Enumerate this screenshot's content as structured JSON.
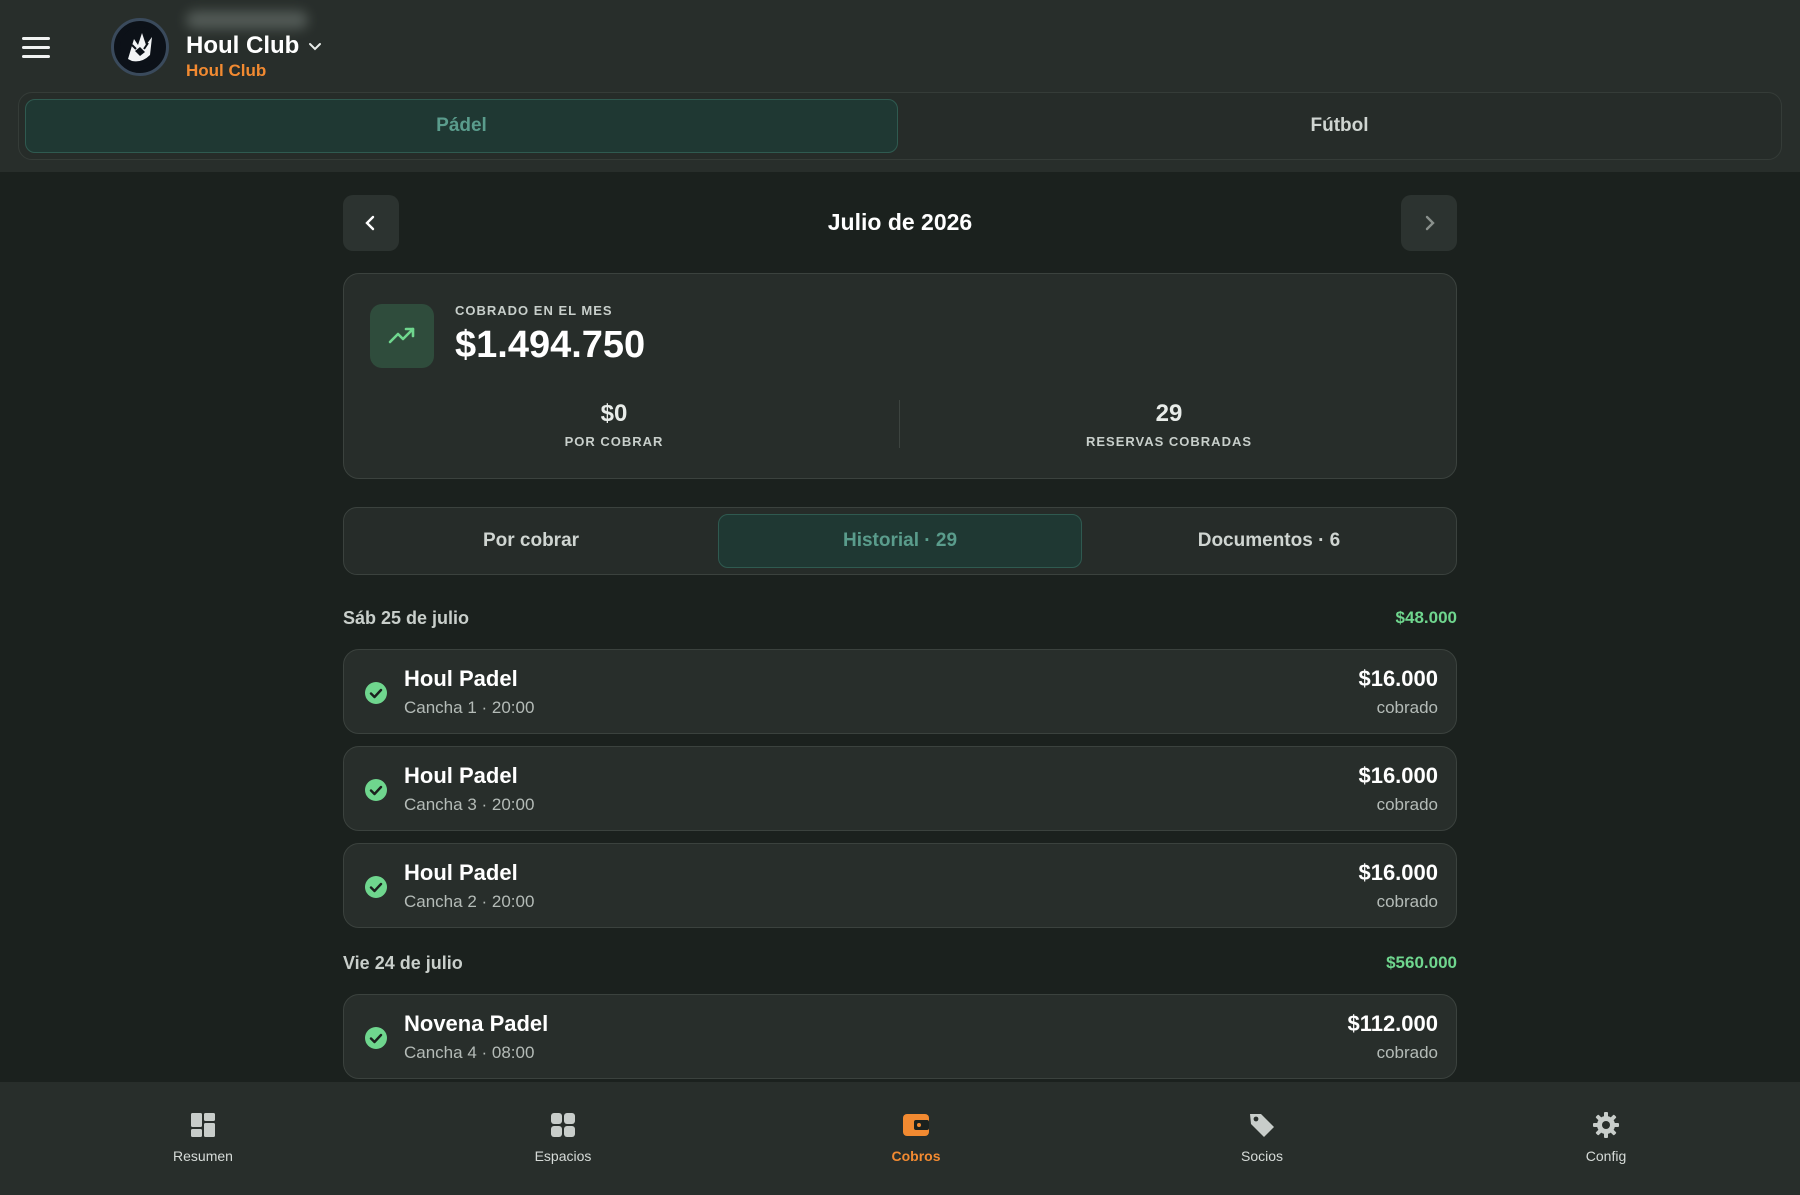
{
  "header": {
    "club_name": "Houl Club",
    "club_subtitle": "Houl Club",
    "menu_icon": "hamburger-icon",
    "dropdown_icon": "chevron-down-icon"
  },
  "sport_tabs": [
    {
      "label": "Pádel",
      "active": true
    },
    {
      "label": "Fútbol",
      "active": false
    }
  ],
  "month": {
    "title": "Julio de 2026"
  },
  "summary": {
    "label": "COBRADO EN EL MES",
    "amount": "$1.494.750",
    "pending_value": "$0",
    "pending_label": "POR COBRAR",
    "reservations_value": "29",
    "reservations_label": "RESERVAS COBRADAS",
    "icon": "trending-up-icon"
  },
  "filter_tabs": [
    {
      "label": "Por cobrar",
      "active": false
    },
    {
      "label": "Historial · 29",
      "active": true
    },
    {
      "label": "Documentos · 6",
      "active": false
    }
  ],
  "days": [
    {
      "date": "Sáb 25 de julio",
      "total": "$48.000",
      "records": [
        {
          "name": "Houl Padel",
          "detail": "Cancha 1 · 20:00",
          "amount": "$16.000",
          "status": "cobrado"
        },
        {
          "name": "Houl Padel",
          "detail": "Cancha 3 · 20:00",
          "amount": "$16.000",
          "status": "cobrado"
        },
        {
          "name": "Houl Padel",
          "detail": "Cancha 2 · 20:00",
          "amount": "$16.000",
          "status": "cobrado"
        }
      ]
    },
    {
      "date": "Vie 24 de julio",
      "total": "$560.000",
      "records": [
        {
          "name": "Novena Padel",
          "detail": "Cancha 4 · 08:00",
          "amount": "$112.000",
          "status": "cobrado"
        }
      ]
    }
  ],
  "bottom_nav": [
    {
      "label": "Resumen",
      "icon": "dashboard-icon",
      "active": false
    },
    {
      "label": "Espacios",
      "icon": "grid-icon",
      "active": false
    },
    {
      "label": "Cobros",
      "icon": "wallet-icon",
      "active": true
    },
    {
      "label": "Socios",
      "icon": "tag-icon",
      "active": false
    },
    {
      "label": "Config",
      "icon": "gear-icon",
      "active": false
    }
  ],
  "colors": {
    "accent_orange": "#f28a31",
    "success_green": "#6fd68e",
    "active_tab_text": "#5a9c8c"
  }
}
